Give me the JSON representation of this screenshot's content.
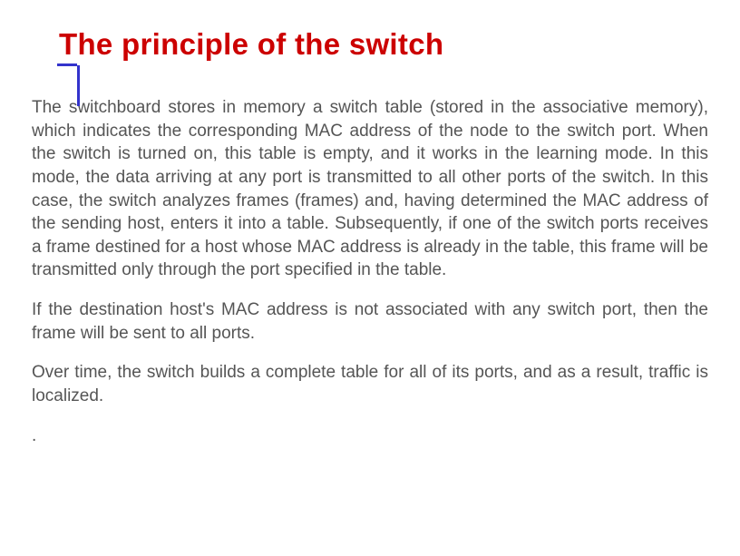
{
  "slide": {
    "title": "The principle of the switch",
    "paragraphs": [
      "The switchboard stores in memory a switch table (stored in the associative memory), which indicates the corresponding MAC address of the node to the switch port. When the switch is turned on, this table is empty, and it works in the learning mode. In this mode, the data arriving at any port is transmitted to all other ports of the switch. In this case, the switch analyzes frames (frames) and, having determined the MAC address of the sending host, enters it into a table. Subsequently, if one of the switch ports receives a frame destined for a host whose MAC address is already in the table, this frame will be transmitted only through the port specified in the table.",
      "If the destination host's MAC address is not associated with any switch port, then the frame will be sent to all ports.",
      "Over time, the switch builds a complete table for all of its ports, and as a result, traffic is localized.",
      "."
    ]
  }
}
